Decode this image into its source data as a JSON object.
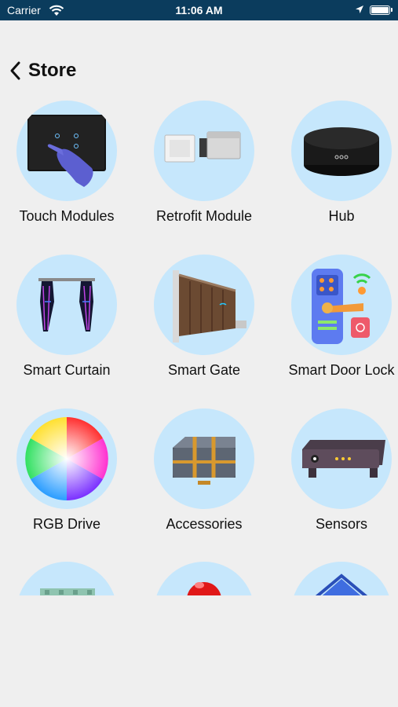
{
  "status_bar": {
    "carrier": "Carrier",
    "time": "11:06 AM"
  },
  "header": {
    "title": "Store"
  },
  "products": [
    {
      "label": "Touch Modules",
      "icon": "touch-module-icon"
    },
    {
      "label": "Retrofit Module",
      "icon": "retrofit-module-icon"
    },
    {
      "label": "Hub",
      "icon": "hub-icon"
    },
    {
      "label": "Smart Curtain",
      "icon": "curtain-icon"
    },
    {
      "label": "Smart Gate",
      "icon": "gate-icon"
    },
    {
      "label": "Smart Door Lock",
      "icon": "door-lock-icon"
    },
    {
      "label": "RGB Drive",
      "icon": "color-wheel-icon"
    },
    {
      "label": "Accessories",
      "icon": "case-icon"
    },
    {
      "label": "Sensors",
      "icon": "sensor-icon"
    },
    {
      "label": "",
      "icon": "led-strip-icon"
    },
    {
      "label": "",
      "icon": "siren-icon"
    },
    {
      "label": "",
      "icon": "house-icon"
    }
  ]
}
